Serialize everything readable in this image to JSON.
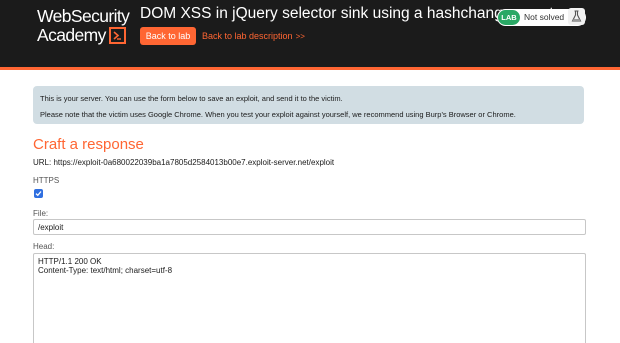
{
  "header": {
    "logo_line1": "WebSecurity",
    "logo_line2": "Academy",
    "lab_title": "DOM XSS in jQuery selector sink using a hashchange event",
    "back_to_lab": "Back to lab",
    "back_to_description": "Back to lab description",
    "status_badge": "LAB",
    "status_text": "Not solved",
    "colors": {
      "background": "#1b1b1b",
      "accent": "#ff6633",
      "badge": "#2aa865"
    }
  },
  "info": {
    "line1": "This is your server. You can use the form below to save an exploit, and send it to the victim.",
    "line2": "Please note that the victim uses Google Chrome. When you test your exploit against yourself, we recommend using Burp's Browser or Chrome."
  },
  "form": {
    "heading": "Craft a response",
    "url_line": "URL: https://exploit-0a680022039ba1a7805d2584013b00e7.exploit-server.net/exploit",
    "https_label": "HTTPS",
    "https_checked": true,
    "file_label": "File:",
    "file_value": "/exploit",
    "head_label": "Head:",
    "head_lines": [
      "HTTP/1.1 200 OK",
      "Content-Type: text/html; charset=utf-8"
    ]
  }
}
